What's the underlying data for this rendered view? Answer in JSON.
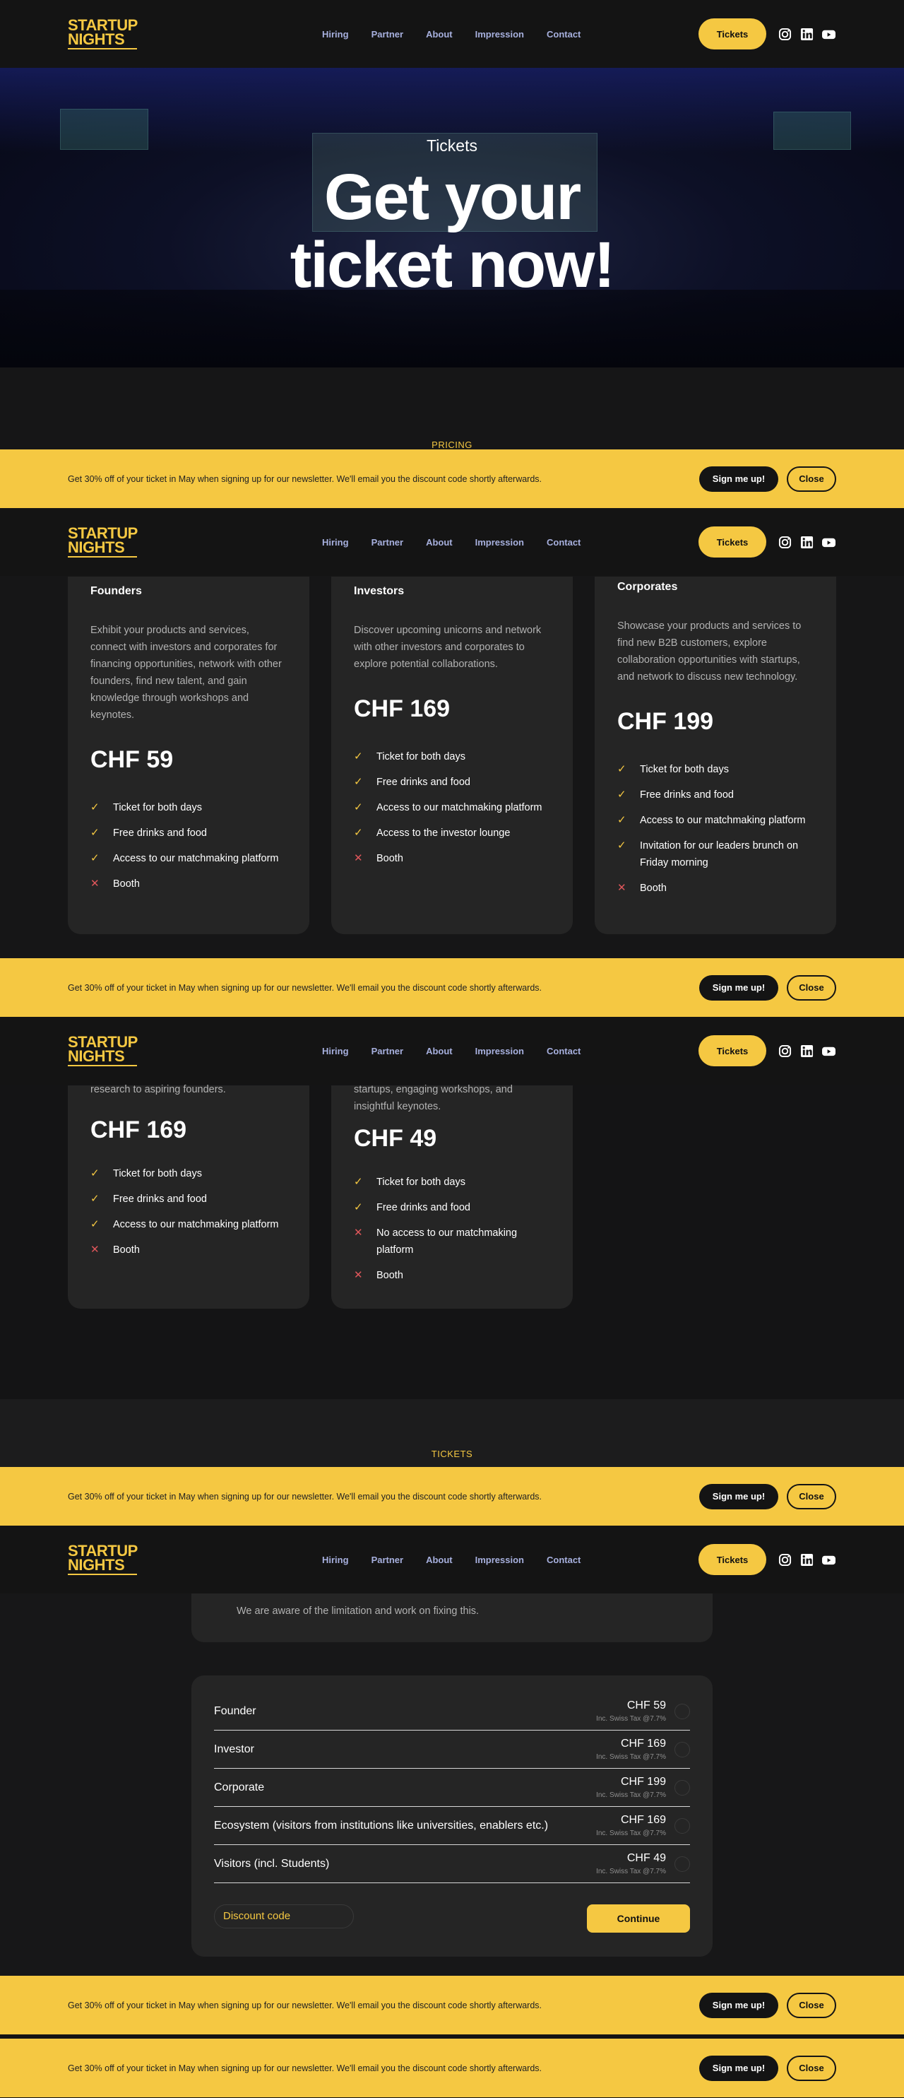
{
  "nav": {
    "logo": "STARTUP NIGHTS",
    "links": [
      "Hiring",
      "Partner",
      "About",
      "Impression",
      "Contact"
    ],
    "tickets_button": "Tickets",
    "social_icons": [
      "instagram-icon",
      "linkedin-icon",
      "youtube-icon"
    ]
  },
  "hero": {
    "subtitle": "Tickets",
    "title": "Get your ticket now!"
  },
  "banner": {
    "text": "Get 30% off of your ticket in May when signing up for our newsletter. We'll email you the discount code shortly afterwards.",
    "sign_label": "Sign me up!",
    "close_label": "Close"
  },
  "pricing": {
    "eyebrow": "PRICING",
    "cards": [
      {
        "title": "Founders",
        "desc": "Exhibit your products and services, connect with investors and corporates for financing opportunities, network with other founders, find new talent, and gain knowledge through workshops and keynotes.",
        "price": "CHF 59",
        "features": [
          {
            "text": "Ticket for both days",
            "included": true
          },
          {
            "text": "Free drinks and food",
            "included": true
          },
          {
            "text": "Access to our matchmaking platform",
            "included": true
          },
          {
            "text": "Booth",
            "included": false
          }
        ]
      },
      {
        "title": "Investors",
        "desc": "Discover upcoming unicorns and network with other investors and corporates to explore potential collaborations.",
        "price": "CHF 169",
        "features": [
          {
            "text": "Ticket for both days",
            "included": true
          },
          {
            "text": "Free drinks and food",
            "included": true
          },
          {
            "text": "Access to our matchmaking platform",
            "included": true
          },
          {
            "text": "Access to the investor lounge",
            "included": true
          },
          {
            "text": "Booth",
            "included": false
          }
        ]
      },
      {
        "title": "Corporates",
        "desc": "Showcase your products and services to find new B2B customers, explore collaboration opportunities with startups, and network to discuss new technology.",
        "price": "CHF 199",
        "features": [
          {
            "text": "Ticket for both days",
            "included": true
          },
          {
            "text": "Free drinks and food",
            "included": true
          },
          {
            "text": "Access to our matchmaking platform",
            "included": true
          },
          {
            "text": "Invitation for our leaders brunch on Friday morning",
            "included": true
          },
          {
            "text": "Booth",
            "included": false
          }
        ]
      }
    ],
    "cards_row2": [
      {
        "desc_tail": "research to aspiring founders.",
        "price": "CHF 169",
        "features": [
          {
            "text": "Ticket for both days",
            "included": true
          },
          {
            "text": "Free drinks and food",
            "included": true
          },
          {
            "text": "Access to our matchmaking platform",
            "included": true
          },
          {
            "text": "Booth",
            "included": false
          }
        ]
      },
      {
        "desc_tail": "startups, engaging workshops, and insightful keynotes.",
        "price": "CHF 49",
        "features": [
          {
            "text": "Ticket for both days",
            "included": true
          },
          {
            "text": "Free drinks and food",
            "included": true
          },
          {
            "text": "No access to our matchmaking platform",
            "included": false
          },
          {
            "text": "Booth",
            "included": false
          }
        ]
      }
    ]
  },
  "tickets": {
    "eyebrow": "TICKETS",
    "notice": "We are aware of the limitation and work on fixing this.",
    "options": [
      {
        "name": "Founder",
        "price": "CHF 59",
        "tax": "Inc. Swiss Tax @7.7%"
      },
      {
        "name": "Investor",
        "price": "CHF 169",
        "tax": "Inc. Swiss Tax @7.7%"
      },
      {
        "name": "Corporate",
        "price": "CHF 199",
        "tax": "Inc. Swiss Tax @7.7%"
      },
      {
        "name": "Ecosystem (visitors from institutions like universities, enablers etc.)",
        "price": "CHF 169",
        "tax": "Inc. Swiss Tax @7.7%"
      },
      {
        "name": "Visitors (incl. Students)",
        "price": "CHF 49",
        "tax": "Inc. Swiss Tax @7.7%"
      }
    ],
    "discount_placeholder": "Discount code",
    "continue_label": "Continue"
  },
  "colors": {
    "accent": "#f5c842",
    "background": "#111112",
    "card": "#252525",
    "cross": "#e0575b"
  }
}
